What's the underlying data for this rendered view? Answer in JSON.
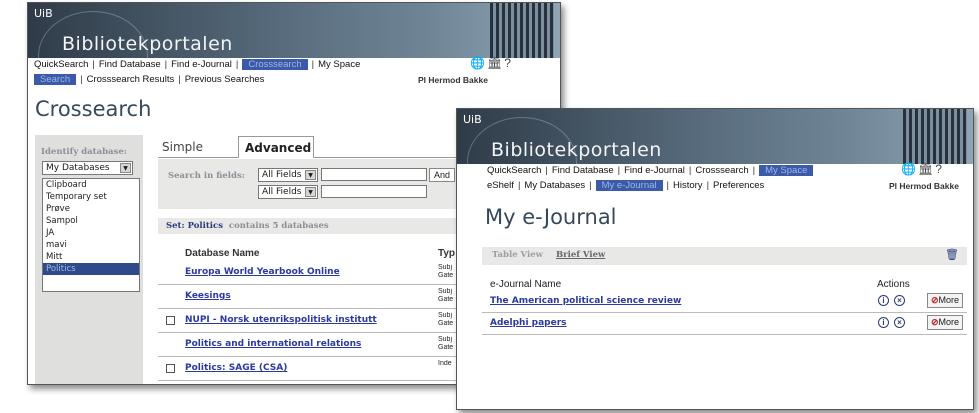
{
  "window1": {
    "brand": "UiB",
    "app_title": "Bibliotekportalen",
    "nav_row1": [
      "QuickSearch",
      "Find Database",
      "Find e-Journal",
      "Crosssearch",
      "My Space"
    ],
    "nav_row1_active": "Crosssearch",
    "nav_row2": [
      "Search",
      "Crosssearch Results",
      "Previous Searches"
    ],
    "nav_row2_active": "Search",
    "user_name": "Pl Hermod Bakke",
    "heading": "Crossearch",
    "identify_label": "Identify database:",
    "db_select_value": "My Databases",
    "db_list": [
      "Clipboard",
      "Temporary set",
      "Prøve",
      "Sampol",
      "JA",
      "mavi",
      "Mitt",
      "Politics"
    ],
    "db_list_selected": "Politics",
    "tabs": [
      "Simple",
      "Advanced"
    ],
    "search_in_fields_label": "Search in fields:",
    "field_select_1": "All Fields",
    "field_select_2": "All Fields",
    "and_label": "And",
    "set_label": "Set: Politics",
    "set_contains": "contains 5 databases",
    "col_db_name": "Database Name",
    "col_type": "Typ",
    "rows": [
      {
        "name": "Europa World Yearbook Online",
        "type": "Subj Gate",
        "checkbox": false
      },
      {
        "name": "Keesings",
        "type": "Subj Gate",
        "checkbox": false
      },
      {
        "name": "NUPI - Norsk utenrikspolitisk institutt",
        "type": "Subj Gate",
        "checkbox": true
      },
      {
        "name": "Politics and international relations",
        "type": "Subj Gate",
        "checkbox": false
      },
      {
        "name": "Politics: SAGE (CSA)",
        "type": "Inde",
        "checkbox": true
      }
    ]
  },
  "window2": {
    "brand": "UiB",
    "app_title": "Bibliotekportalen",
    "nav_row1": [
      "QuickSearch",
      "Find Database",
      "Find e-Journal",
      "Crosssearch",
      "My Space"
    ],
    "nav_row1_active": "My Space",
    "nav_row2": [
      "eShelf",
      "My Databases",
      "My e-Journal",
      "History",
      "Preferences"
    ],
    "nav_row2_active": "My e-Journal",
    "user_name": "Pl Hermod Bakke",
    "heading": "My e-Journal",
    "table_view": "Table View",
    "brief_view": "Brief View",
    "col_name": "e-Journal Name",
    "col_actions": "Actions",
    "more_label": "More",
    "rows": [
      {
        "name": "The American political science review"
      },
      {
        "name": "Adelphi papers"
      }
    ]
  },
  "icons": {
    "info": "info-icon",
    "remove": "remove-icon",
    "more": "more-icon",
    "trash": "trash-icon",
    "globe": "globe-icon",
    "library": "library-icon",
    "help": "help-icon"
  }
}
